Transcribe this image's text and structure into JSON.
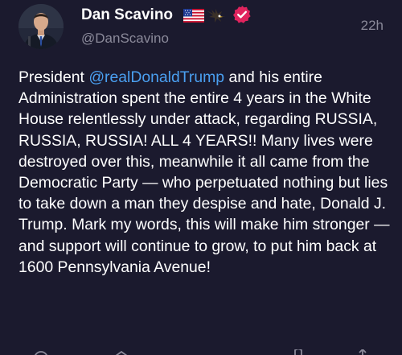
{
  "tweet": {
    "author": {
      "display_name": "Dan Scavino",
      "handle": "@DanScavino",
      "name_emojis": [
        "us-flag-icon",
        "eagle-icon"
      ],
      "verified": true
    },
    "timestamp": "22h",
    "text_before": "President ",
    "mention": "@realDonaldTrump",
    "text_after": " and his entire Administration spent the entire 4 years in the White House relentlessly under attack, regarding RUSSIA, RUSSIA, RUSSIA! ALL 4 YEARS!! Many lives were destroyed over this, meanwhile it all came from the Democratic Party — who perpetuated nothing but lies to take down a man they despise and hate, Donald J. Trump. Mark my words, this will make him stronger — and support will continue to grow, to put him back at 1600 Pennsylvania Avenue!",
    "actions": [
      "reply-icon",
      "retweet-icon",
      "like-icon",
      "views-icon",
      "bookmark-icon",
      "share-icon"
    ]
  },
  "colors": {
    "background": "#1b1a2e",
    "text": "#ffffff",
    "secondary_text": "#8b8a9a",
    "mention": "#4a9ff0",
    "verified_badge": "#e0245e"
  }
}
